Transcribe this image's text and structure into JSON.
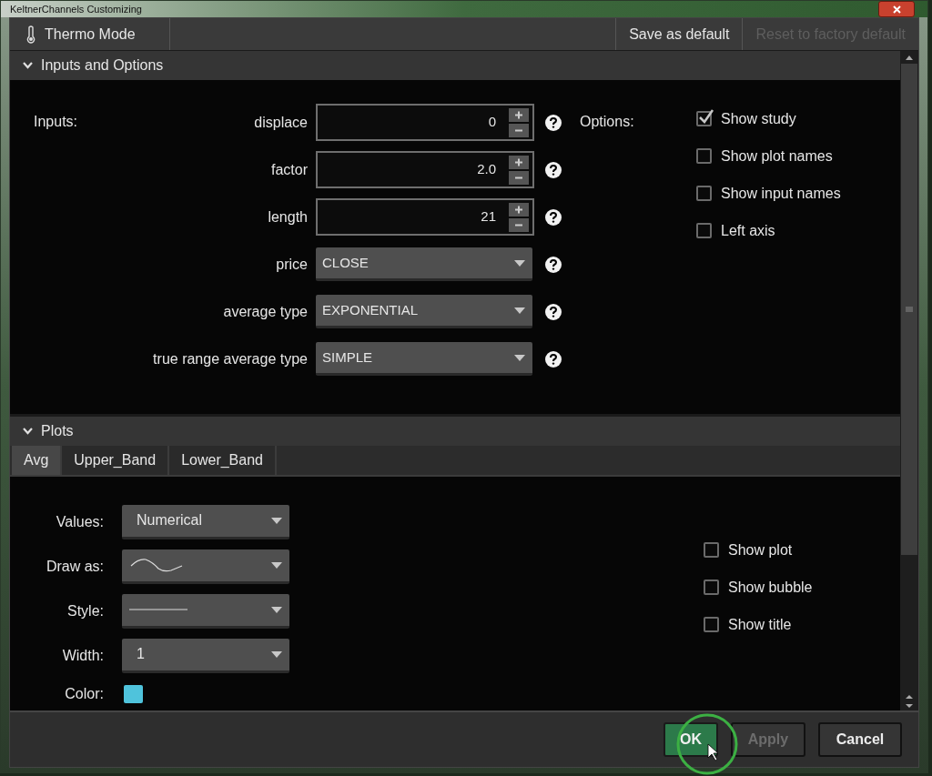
{
  "window": {
    "title": "KeltnerChannels Customizing"
  },
  "toolbar": {
    "thermo_mode": {
      "label": "Thermo Mode"
    },
    "buttons": [
      {
        "label": "Save as default",
        "disabled": false
      },
      {
        "label": "Reset to factory default",
        "disabled": true
      }
    ]
  },
  "inputs_and_options": {
    "title": "Inputs and Options",
    "expanded": true,
    "inputs_label": "Inputs:",
    "options_label": "Options:",
    "inputs": [
      {
        "kind": "spinner",
        "name": "displace",
        "value": "0"
      },
      {
        "kind": "spinner",
        "name": "factor",
        "value": "2.0"
      },
      {
        "kind": "spinner",
        "name": "length",
        "value": "21"
      },
      {
        "kind": "dropdown",
        "name": "price",
        "value": "CLOSE"
      },
      {
        "kind": "dropdown",
        "name": "average type",
        "value": "EXPONENTIAL"
      },
      {
        "kind": "dropdown",
        "name": "true range average type",
        "value": "SIMPLE"
      }
    ],
    "options": [
      {
        "label": "Show study",
        "checked": true
      },
      {
        "label": "Show plot names",
        "checked": false
      },
      {
        "label": "Show input names",
        "checked": false
      },
      {
        "label": "Left axis",
        "checked": false
      }
    ]
  },
  "plots": {
    "title": "Plots",
    "expanded": true,
    "tabs": [
      {
        "label": "Avg",
        "selected": true
      },
      {
        "label": "Upper_Band",
        "selected": false
      },
      {
        "label": "Lower_Band",
        "selected": false
      }
    ],
    "fields": [
      {
        "kind": "dropdown",
        "label": "Values:",
        "value": "Numerical"
      },
      {
        "kind": "wave",
        "label": "Draw as:"
      },
      {
        "kind": "line",
        "label": "Style:"
      },
      {
        "kind": "dropdown",
        "label": "Width:",
        "value": "1"
      },
      {
        "kind": "color",
        "label": "Color:",
        "color": "#4fc3dc"
      }
    ],
    "options": [
      {
        "label": "Show plot",
        "checked": false
      },
      {
        "label": "Show bubble",
        "checked": false
      },
      {
        "label": "Show title",
        "checked": false
      }
    ]
  },
  "footer": {
    "buttons": [
      {
        "label": "OK",
        "kind": "primary",
        "disabled": false
      },
      {
        "label": "Apply",
        "kind": "default",
        "disabled": true
      },
      {
        "label": "Cancel",
        "kind": "default",
        "disabled": false
      }
    ]
  }
}
